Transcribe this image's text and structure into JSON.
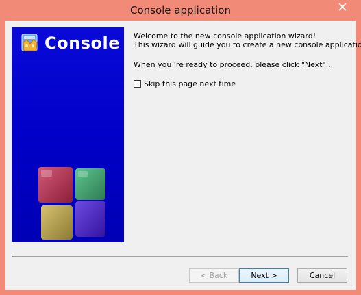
{
  "window": {
    "title": "Console application",
    "close_icon": "close-icon"
  },
  "side_panel": {
    "brand_text": "Console",
    "logo_icon": "codeblocks-logo-icon",
    "graphic_icon": "cubes-icon"
  },
  "content": {
    "welcome": "Welcome to the new console application wizard!",
    "guide": "This wizard will guide you to create a new console application.",
    "proceed": "When you 're ready to proceed, please click \"Next\"...",
    "skip_label": "Skip this page next time",
    "skip_checked": false
  },
  "buttons": {
    "back": "< Back",
    "next": "Next >",
    "cancel": "Cancel"
  }
}
